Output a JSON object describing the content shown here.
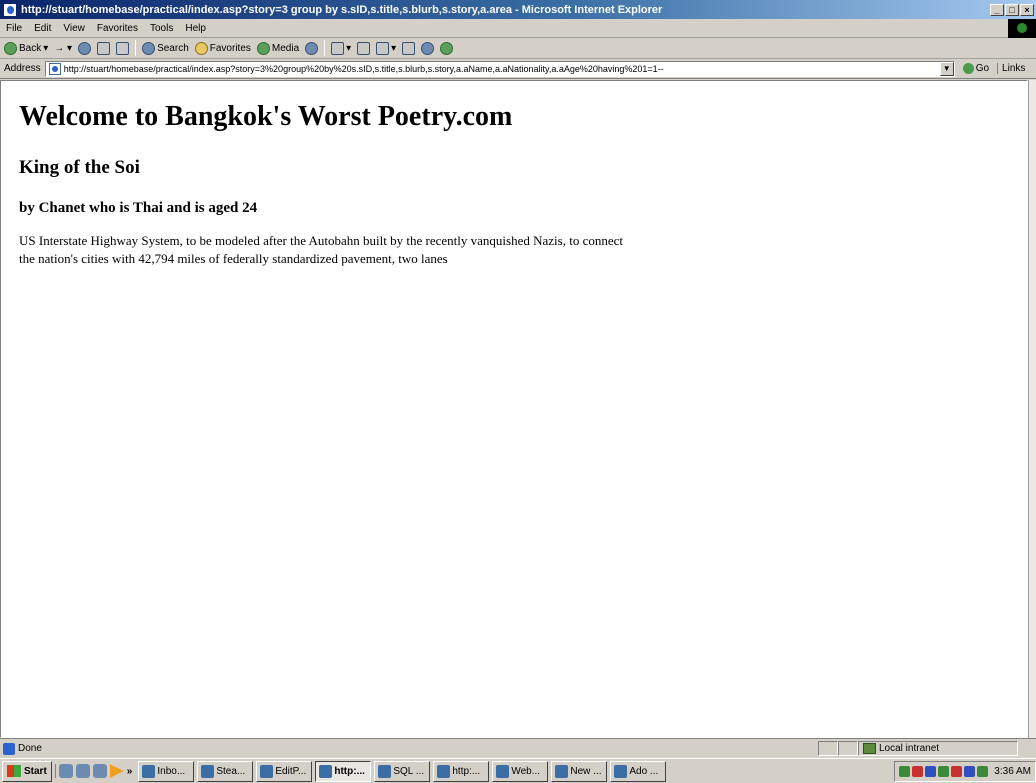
{
  "window": {
    "title": "http://stuart/homebase/practical/index.asp?story=3 group by s.sID,s.title,s.blurb,s.story,a.area - Microsoft Internet Explorer"
  },
  "menu": [
    "File",
    "Edit",
    "View",
    "Favorites",
    "Tools",
    "Help"
  ],
  "toolbar": {
    "back": "Back",
    "search": "Search",
    "favorites": "Favorites",
    "media": "Media"
  },
  "address": {
    "label": "Address",
    "url": "http://stuart/homebase/practical/index.asp?story=3%20group%20by%20s.sID,s.title,s.blurb,s.story,a.aName,a.aNationality,a.aAge%20having%201=1--",
    "go": "Go",
    "links": "Links"
  },
  "page": {
    "heading": "Welcome to Bangkok's Worst Poetry.com",
    "story_title": "King of the Soi",
    "byline": "by Chanet who is Thai and is aged 24",
    "body": "US Interstate Highway System, to be modeled after the Autobahn built by the recently vanquished Nazis, to connect the nation's cities with 42,794 miles of federally standardized pavement, two lanes"
  },
  "status": {
    "text": "Done",
    "zone": "Local intranet"
  },
  "taskbar": {
    "start": "Start",
    "more": "»",
    "tasks": [
      "Inbo...",
      "Stea...",
      "EditP...",
      "http:...",
      "SQL ...",
      "http:...",
      "Web...",
      "New ...",
      "Ado ..."
    ],
    "active_index": 3,
    "clock": "3:36 AM"
  }
}
